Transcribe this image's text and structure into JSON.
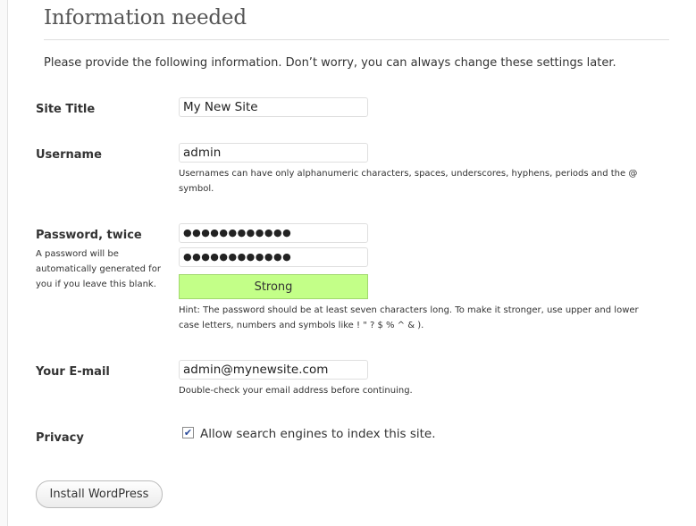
{
  "heading": "Information needed",
  "intro": "Please provide the following information. Don’t worry, you can always change these settings later.",
  "site_title": {
    "label": "Site Title",
    "value": "My New Site"
  },
  "username": {
    "label": "Username",
    "value": "admin",
    "hint": "Usernames can have only alphanumeric characters, spaces, underscores, hyphens, periods and the @ symbol."
  },
  "password": {
    "label": "Password, twice",
    "sublabel": "A password will be automatically generated for you if you leave this blank.",
    "value1_masked": "●●●●●●●●●●●●",
    "value2_masked": "●●●●●●●●●●●●",
    "strength": "Strong",
    "strength_color": "#c3ff88",
    "hint": "Hint: The password should be at least seven characters long. To make it stronger, use upper and lower case letters, numbers and symbols like ! \" ? $ % ^ & )."
  },
  "email": {
    "label": "Your E-mail",
    "value": "admin@mynewsite.com",
    "hint": "Double-check your email address before continuing."
  },
  "privacy": {
    "label": "Privacy",
    "checkbox_label": "Allow search engines to index this site.",
    "checked": true,
    "check_glyph": "✔"
  },
  "install_button": "Install WordPress"
}
